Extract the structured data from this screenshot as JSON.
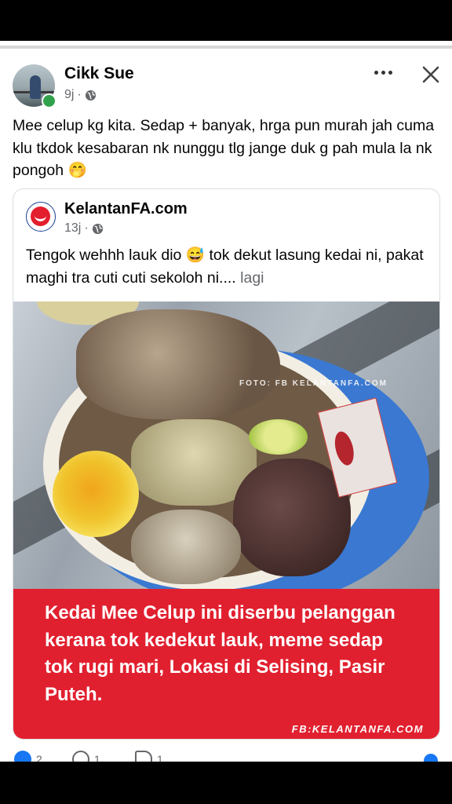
{
  "post": {
    "author": "Cikk Sue",
    "time": "9j",
    "privacy_icon": "globe-icon",
    "text": "Mee celup kg kita. Sedap + banyak, hrga pun murah jah cuma klu tkdok kesabaran nk nunggu tlg jange duk g pah mula la nk pongoh 🤭"
  },
  "shared": {
    "page_name": "KelantanFA.com",
    "time": "13j",
    "text": "Tengok wehhh lauk dio 😅 tok dekut lasung kedai ni, pakat maghi tra cuti cuti sekoloh ni....",
    "see_more": "lagi",
    "photo_credit": "FOTO: FB KELANTANFA.COM",
    "banner_text": "Kedai Mee Celup ini diserbu pelanggan kerana tok kedekut lauk, meme sedap tok rugi mari, Lokasi di Selising, Pasir Puteh.",
    "banner_credit": "FB:KELANTANFA.COM"
  },
  "actions": {
    "likes": "2",
    "comments": "1",
    "shares": "1"
  },
  "colors": {
    "online": "#31a24c",
    "banner": "#e1202f",
    "link_blue": "#1877f2",
    "meta_gray": "#65676b"
  }
}
